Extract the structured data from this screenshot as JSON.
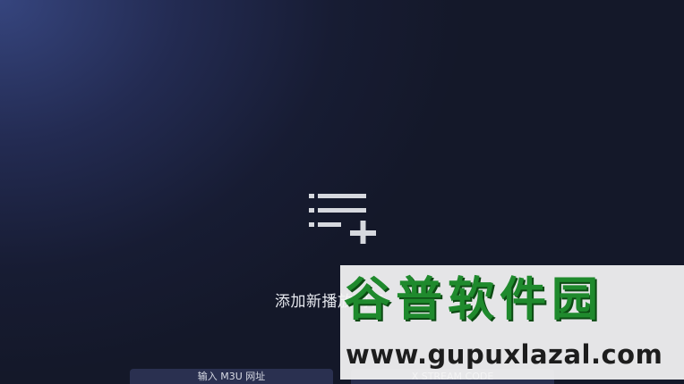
{
  "main": {
    "add_playlist_label": "添加新播放列表",
    "add_playlist_icon": "playlist-add-icon"
  },
  "bottom_bar": {
    "m3u_button_label": "输入 M3U 网址",
    "xstream_button_label": "X STREAM CODE"
  },
  "watermark": {
    "title": "谷普软件园",
    "url": "www.gupuxlazal.com"
  },
  "colors": {
    "background_dark": "#141829",
    "background_glow": "#36457e",
    "icon": "#d6d8de",
    "watermark_green": "#1f8a2d"
  }
}
